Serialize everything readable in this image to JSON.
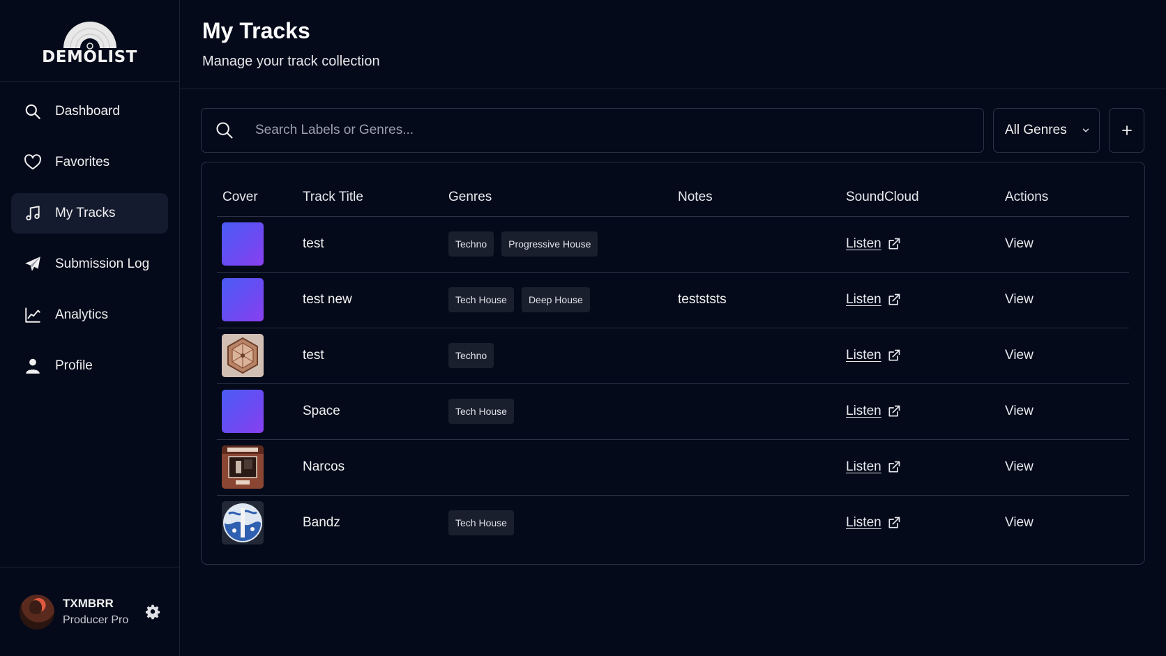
{
  "brand": {
    "name": "DEMOLIST"
  },
  "sidebar": {
    "items": [
      {
        "label": "Dashboard",
        "icon": "search-icon",
        "active": false
      },
      {
        "label": "Favorites",
        "icon": "heart-icon",
        "active": false
      },
      {
        "label": "My Tracks",
        "icon": "music-note-icon",
        "active": true
      },
      {
        "label": "Submission Log",
        "icon": "paper-plane-icon",
        "active": false
      },
      {
        "label": "Analytics",
        "icon": "line-chart-icon",
        "active": false
      },
      {
        "label": "Profile",
        "icon": "user-icon",
        "active": false
      }
    ]
  },
  "user": {
    "name": "TXMBRR",
    "role": "Producer Pro"
  },
  "header": {
    "title": "My Tracks",
    "subtitle": "Manage your track collection"
  },
  "search": {
    "placeholder": "Search Labels or Genres...",
    "value": ""
  },
  "filter": {
    "selected": "All Genres"
  },
  "table": {
    "columns": [
      "Cover",
      "Track Title",
      "Genres",
      "Notes",
      "SoundCloud",
      "Actions"
    ],
    "rows": [
      {
        "cover": "gradient",
        "title": "test",
        "genres": [
          "Techno",
          "Progressive House"
        ],
        "notes": "",
        "soundcloud": "Listen",
        "action": "View"
      },
      {
        "cover": "gradient",
        "title": "test new",
        "genres": [
          "Tech House",
          "Deep House"
        ],
        "notes": "testststs",
        "soundcloud": "Listen",
        "action": "View"
      },
      {
        "cover": "art-hexagon",
        "title": "test",
        "genres": [
          "Techno"
        ],
        "notes": "",
        "soundcloud": "Listen",
        "action": "View"
      },
      {
        "cover": "gradient",
        "title": "Space",
        "genres": [
          "Tech House"
        ],
        "notes": "",
        "soundcloud": "Listen",
        "action": "View"
      },
      {
        "cover": "art-narcos",
        "title": "Narcos",
        "genres": [],
        "notes": "",
        "soundcloud": "Listen",
        "action": "View"
      },
      {
        "cover": "art-bandz",
        "title": "Bandz",
        "genres": [
          "Tech House"
        ],
        "notes": "",
        "soundcloud": "Listen",
        "action": "View"
      }
    ]
  },
  "colors": {
    "background": "#050a1a",
    "border": "#2c3347",
    "accent_gradient_start": "#4a5cf5",
    "accent_gradient_end": "#8a3ff0",
    "tag_bg": "#1a1f2e"
  }
}
